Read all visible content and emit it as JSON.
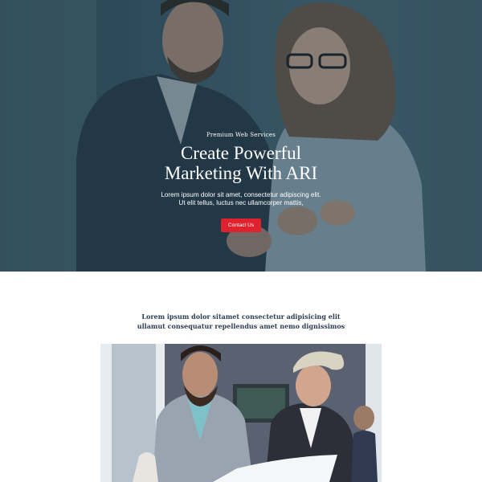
{
  "hero": {
    "kicker": "Premium Web Services",
    "title_line1": "Create Powerful",
    "title_line2": "Marketing With ARI",
    "text_line1": "Lorem ipsum dolor sit amet, consectetur adipiscing elit. Ut",
    "text_line2": "elit tellus, luctus nec ullamcorper mattis,",
    "button_label": "Contact Us"
  },
  "intro": {
    "line1": "Lorem ipsum dolor sitamet consectetur adipisicing elit",
    "line2": "ullamut consequatur repellendus amet nemo dignissimos"
  },
  "colors": {
    "accent": "#e0212e",
    "heading": "#2d3e54",
    "hero_tint": "#3c5a6a"
  }
}
